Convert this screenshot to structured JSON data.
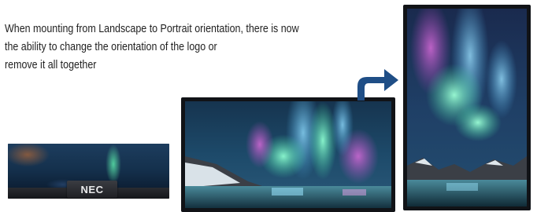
{
  "description": {
    "lines": [
      "When mounting from Landscape to Portrait orientation, there is now",
      "the ability to change the orientation of the logo or",
      "remove it all together"
    ]
  },
  "closeup": {
    "logo_text": "NEC"
  },
  "colors": {
    "text": "#222222",
    "arrow": "#1f4e86",
    "bezel": "#111317"
  },
  "icons": {
    "arrow": "curved-rotation-arrow-icon"
  }
}
